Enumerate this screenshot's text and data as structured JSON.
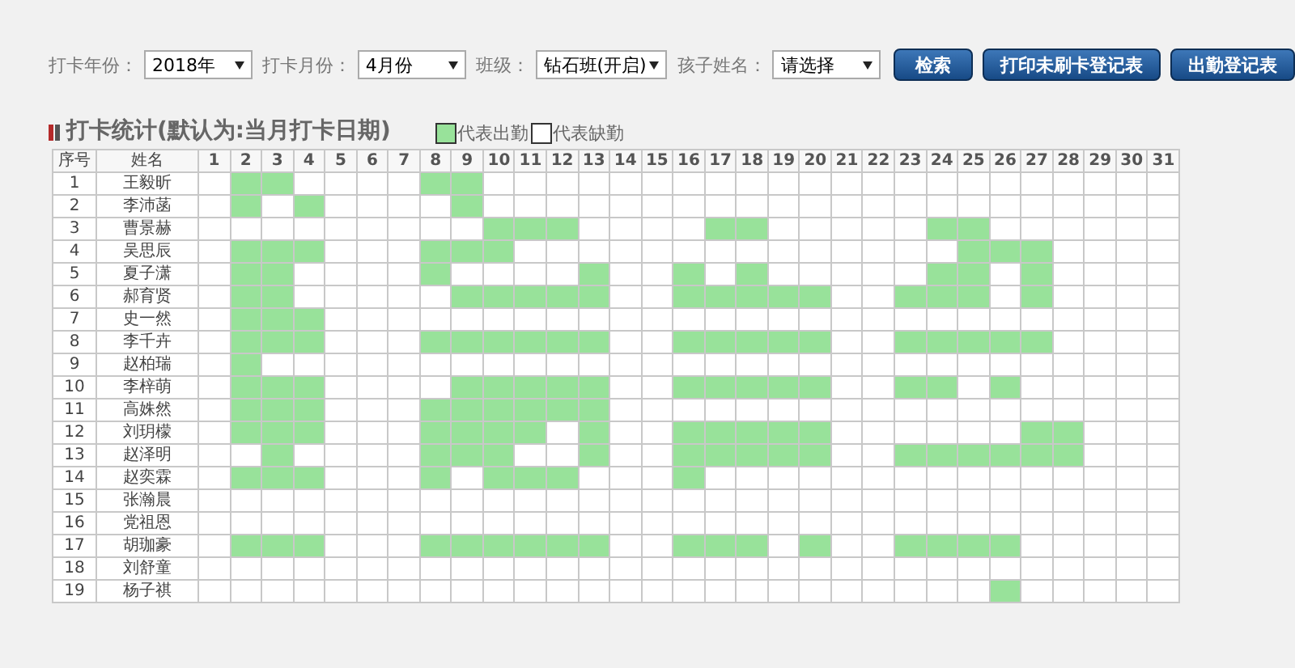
{
  "filters": [
    {
      "label": "打卡年份：",
      "value": "2018年"
    },
    {
      "label": "打卡月份：",
      "value": "4月份"
    },
    {
      "label": "班级：",
      "value": "钻石班(开启)"
    },
    {
      "label": "孩子姓名：",
      "value": "请选择"
    }
  ],
  "buttons": [
    "检索",
    "打印未刷卡登记表",
    "出勤登记表"
  ],
  "section": {
    "title": "打卡统计(默认为:当月打卡日期)",
    "legend": [
      {
        "label": "代表出勤",
        "present": true
      },
      {
        "label": "代表缺勤",
        "present": false
      }
    ]
  },
  "table": {
    "columns": [
      "序号",
      "姓名"
    ],
    "days": [
      "1",
      "2",
      "3",
      "4",
      "5",
      "6",
      "7",
      "8",
      "9",
      "10",
      "11",
      "12",
      "13",
      "14",
      "15",
      "16",
      "17",
      "18",
      "19",
      "20",
      "21",
      "22",
      "23",
      "24",
      "25",
      "26",
      "27",
      "28",
      "29",
      "30",
      "31"
    ],
    "rows": [
      {
        "no": "1",
        "name": "王毅昕",
        "present": [
          false,
          true,
          true,
          false,
          false,
          false,
          false,
          true,
          true,
          false,
          false,
          false,
          false,
          false,
          false,
          false,
          false,
          false,
          false,
          false,
          false,
          false,
          false,
          false,
          false,
          false,
          false,
          false,
          false,
          false,
          false
        ]
      },
      {
        "no": "2",
        "name": "李沛菡",
        "present": [
          false,
          true,
          false,
          true,
          false,
          false,
          false,
          false,
          true,
          false,
          false,
          false,
          false,
          false,
          false,
          false,
          false,
          false,
          false,
          false,
          false,
          false,
          false,
          false,
          false,
          false,
          false,
          false,
          false,
          false,
          false
        ]
      },
      {
        "no": "3",
        "name": "曹景赫",
        "present": [
          false,
          false,
          false,
          false,
          false,
          false,
          false,
          false,
          false,
          true,
          true,
          true,
          false,
          false,
          false,
          false,
          true,
          true,
          false,
          false,
          false,
          false,
          false,
          true,
          true,
          false,
          false,
          false,
          false,
          false,
          false
        ]
      },
      {
        "no": "4",
        "name": "吴思辰",
        "present": [
          false,
          true,
          true,
          true,
          false,
          false,
          false,
          true,
          true,
          true,
          false,
          false,
          false,
          false,
          false,
          false,
          false,
          false,
          false,
          false,
          false,
          false,
          false,
          false,
          true,
          true,
          true,
          false,
          false,
          false,
          false
        ]
      },
      {
        "no": "5",
        "name": "夏子潇",
        "present": [
          false,
          true,
          true,
          false,
          false,
          false,
          false,
          true,
          false,
          false,
          false,
          false,
          true,
          false,
          false,
          true,
          false,
          true,
          false,
          false,
          false,
          false,
          false,
          true,
          true,
          false,
          true,
          false,
          false,
          false,
          false
        ]
      },
      {
        "no": "6",
        "name": "郝育贤",
        "present": [
          false,
          true,
          true,
          false,
          false,
          false,
          false,
          false,
          true,
          true,
          true,
          true,
          true,
          false,
          false,
          true,
          true,
          true,
          true,
          true,
          false,
          false,
          true,
          true,
          true,
          false,
          true,
          false,
          false,
          false,
          false
        ]
      },
      {
        "no": "7",
        "name": "史一然",
        "present": [
          false,
          true,
          true,
          true,
          false,
          false,
          false,
          false,
          false,
          false,
          false,
          false,
          false,
          false,
          false,
          false,
          false,
          false,
          false,
          false,
          false,
          false,
          false,
          false,
          false,
          false,
          false,
          false,
          false,
          false,
          false
        ]
      },
      {
        "no": "8",
        "name": "李千卉",
        "present": [
          false,
          true,
          true,
          true,
          false,
          false,
          false,
          true,
          true,
          true,
          true,
          true,
          true,
          false,
          false,
          true,
          true,
          true,
          true,
          true,
          false,
          false,
          true,
          true,
          true,
          true,
          true,
          false,
          false,
          false,
          false
        ]
      },
      {
        "no": "9",
        "name": "赵柏瑞",
        "present": [
          false,
          true,
          false,
          false,
          false,
          false,
          false,
          false,
          false,
          false,
          false,
          false,
          false,
          false,
          false,
          false,
          false,
          false,
          false,
          false,
          false,
          false,
          false,
          false,
          false,
          false,
          false,
          false,
          false,
          false,
          false
        ]
      },
      {
        "no": "10",
        "name": "李梓萌",
        "present": [
          false,
          true,
          true,
          true,
          false,
          false,
          false,
          false,
          true,
          true,
          true,
          true,
          true,
          false,
          false,
          true,
          true,
          true,
          true,
          true,
          false,
          false,
          true,
          true,
          false,
          true,
          false,
          false,
          false,
          false,
          false
        ]
      },
      {
        "no": "11",
        "name": "高姝然",
        "present": [
          false,
          true,
          true,
          true,
          false,
          false,
          false,
          true,
          true,
          true,
          true,
          true,
          true,
          false,
          false,
          false,
          false,
          false,
          false,
          false,
          false,
          false,
          false,
          false,
          false,
          false,
          false,
          false,
          false,
          false,
          false
        ]
      },
      {
        "no": "12",
        "name": "刘玥檬",
        "present": [
          false,
          true,
          true,
          true,
          false,
          false,
          false,
          true,
          true,
          true,
          true,
          false,
          true,
          false,
          false,
          true,
          true,
          true,
          true,
          true,
          false,
          false,
          false,
          false,
          false,
          false,
          true,
          true,
          false,
          false,
          false
        ]
      },
      {
        "no": "13",
        "name": "赵泽明",
        "present": [
          false,
          false,
          true,
          false,
          false,
          false,
          false,
          true,
          true,
          true,
          false,
          false,
          true,
          false,
          false,
          true,
          true,
          true,
          true,
          true,
          false,
          false,
          true,
          true,
          true,
          true,
          true,
          true,
          false,
          false,
          false
        ]
      },
      {
        "no": "14",
        "name": "赵奕霖",
        "present": [
          false,
          true,
          true,
          true,
          false,
          false,
          false,
          true,
          false,
          true,
          true,
          true,
          false,
          false,
          false,
          true,
          false,
          false,
          false,
          false,
          false,
          false,
          false,
          false,
          false,
          false,
          false,
          false,
          false,
          false,
          false
        ]
      },
      {
        "no": "15",
        "name": "张瀚晨",
        "present": [
          false,
          false,
          false,
          false,
          false,
          false,
          false,
          false,
          false,
          false,
          false,
          false,
          false,
          false,
          false,
          false,
          false,
          false,
          false,
          false,
          false,
          false,
          false,
          false,
          false,
          false,
          false,
          false,
          false,
          false,
          false
        ]
      },
      {
        "no": "16",
        "name": "党祖恩",
        "present": [
          false,
          false,
          false,
          false,
          false,
          false,
          false,
          false,
          false,
          false,
          false,
          false,
          false,
          false,
          false,
          false,
          false,
          false,
          false,
          false,
          false,
          false,
          false,
          false,
          false,
          false,
          false,
          false,
          false,
          false,
          false
        ]
      },
      {
        "no": "17",
        "name": "胡珈豪",
        "present": [
          false,
          true,
          true,
          true,
          false,
          false,
          false,
          true,
          true,
          true,
          true,
          true,
          true,
          false,
          false,
          true,
          true,
          true,
          false,
          true,
          false,
          false,
          true,
          true,
          true,
          true,
          false,
          false,
          false,
          false,
          false
        ]
      },
      {
        "no": "18",
        "name": "刘舒童",
        "present": [
          false,
          false,
          false,
          false,
          false,
          false,
          false,
          false,
          false,
          false,
          false,
          false,
          false,
          false,
          false,
          false,
          false,
          false,
          false,
          false,
          false,
          false,
          false,
          false,
          false,
          false,
          false,
          false,
          false,
          false,
          false
        ]
      },
      {
        "no": "19",
        "name": "杨子祺",
        "present": [
          false,
          false,
          false,
          false,
          false,
          false,
          false,
          false,
          false,
          false,
          false,
          false,
          false,
          false,
          false,
          false,
          false,
          false,
          false,
          false,
          false,
          false,
          false,
          false,
          false,
          true,
          false,
          false,
          false,
          false,
          false
        ]
      }
    ]
  }
}
